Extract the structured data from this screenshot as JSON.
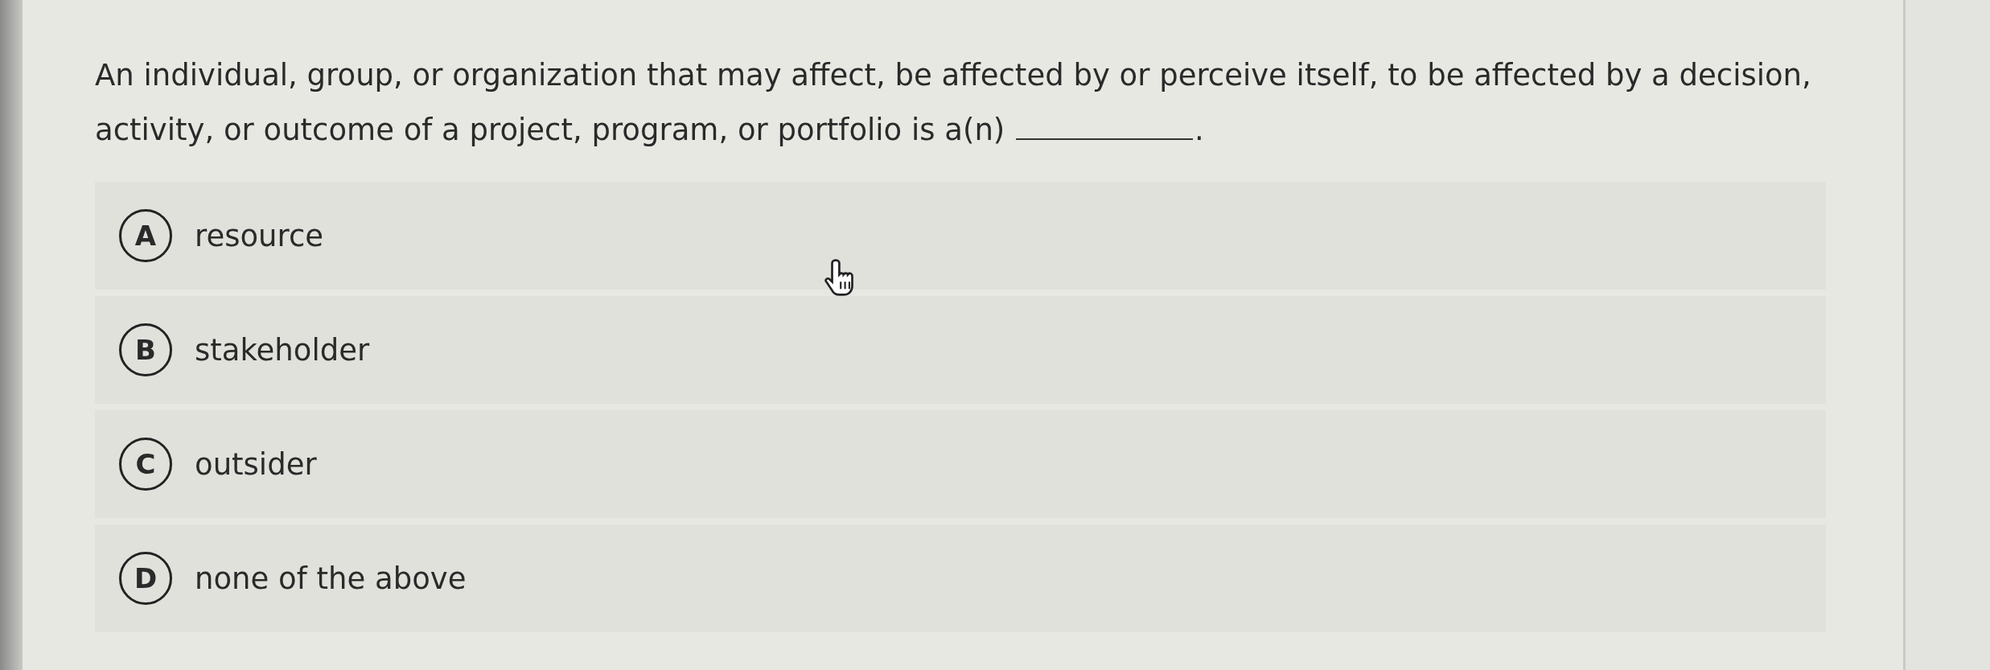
{
  "question": {
    "text": "An individual, group, or organization that may affect, be affected by or perceive itself, to be affected by a decision, activity, or outcome of a project, program, or portfolio is a(n)",
    "end": "."
  },
  "options": [
    {
      "letter": "A",
      "text": "resource"
    },
    {
      "letter": "B",
      "text": "stakeholder"
    },
    {
      "letter": "C",
      "text": "outsider"
    },
    {
      "letter": "D",
      "text": "none of the above"
    }
  ]
}
